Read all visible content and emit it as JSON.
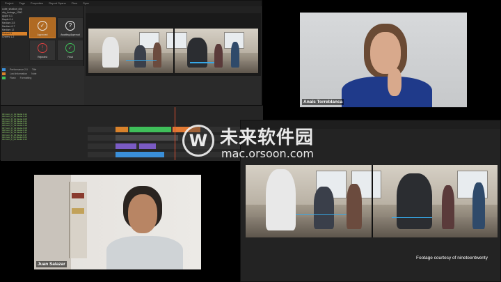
{
  "editor": {
    "menu": [
      "Project",
      "Tags",
      "Properties",
      "Report Spans",
      "Flow",
      "Sync"
    ],
    "bin_items": [
      "cube_shadow_clip",
      "city_footage_1080",
      "Apple 0-1",
      "Maple 0-4",
      "Medium 3-5",
      "Medium 6-7",
      "Medium 12",
      "Subset 3",
      "Cheers 1-2"
    ],
    "selected_bin_index": 7,
    "status_tiles": [
      {
        "label": "Approved",
        "glyph": "✓",
        "active": true
      },
      {
        "label": "Awaiting Approval",
        "glyph": "?",
        "active": false
      },
      {
        "label": "Rejected",
        "glyph": "!",
        "active": false,
        "tone": "red"
      },
      {
        "label": "Final",
        "glyph": "✓",
        "active": false,
        "tone": "green"
      }
    ],
    "props_rows": [
      {
        "name": "Performance 2.0",
        "value": "Title",
        "color": "#3a8fd9"
      },
      {
        "name": "Lost Information",
        "value": "Note",
        "color": "#d9822b"
      },
      {
        "name": "Flash",
        "value": "Formatting",
        "color": "#3fbf5a"
      }
    ],
    "timeline_list": [
      "001  cam_A_01  Media  0.12",
      "002  cam_A_02  Media  0.15",
      "003  cam_B_01  Media  0.08",
      "004  cam_B_02  Media  0.21",
      "005  cam_C_01  Media  0.10",
      "006  cam_C_03  Media  0.19",
      "007  cam_D_01  Media  0.06",
      "008  cam_D_02  Media  0.14",
      "009  cam_E_01  Media  0.11",
      "010  cam_E_04  Media  0.17",
      "011  cam_F_01  Media  0.09",
      "012  cam_F_02  Media  0.13"
    ]
  },
  "participants": [
    {
      "name": "Anaïs Torreblanca"
    },
    {
      "name": "Juan Salazar"
    }
  ],
  "big_viewer": {
    "caption": "Footage courtesy of nineteentwenty"
  },
  "watermark": {
    "brand_cn": "未来软件园",
    "url": "mac.orsoon.com"
  },
  "colors": {
    "orange_accent": "#d9822b",
    "tracking_blue": "#36a8e8",
    "clip_green": "#3fbf5a"
  }
}
